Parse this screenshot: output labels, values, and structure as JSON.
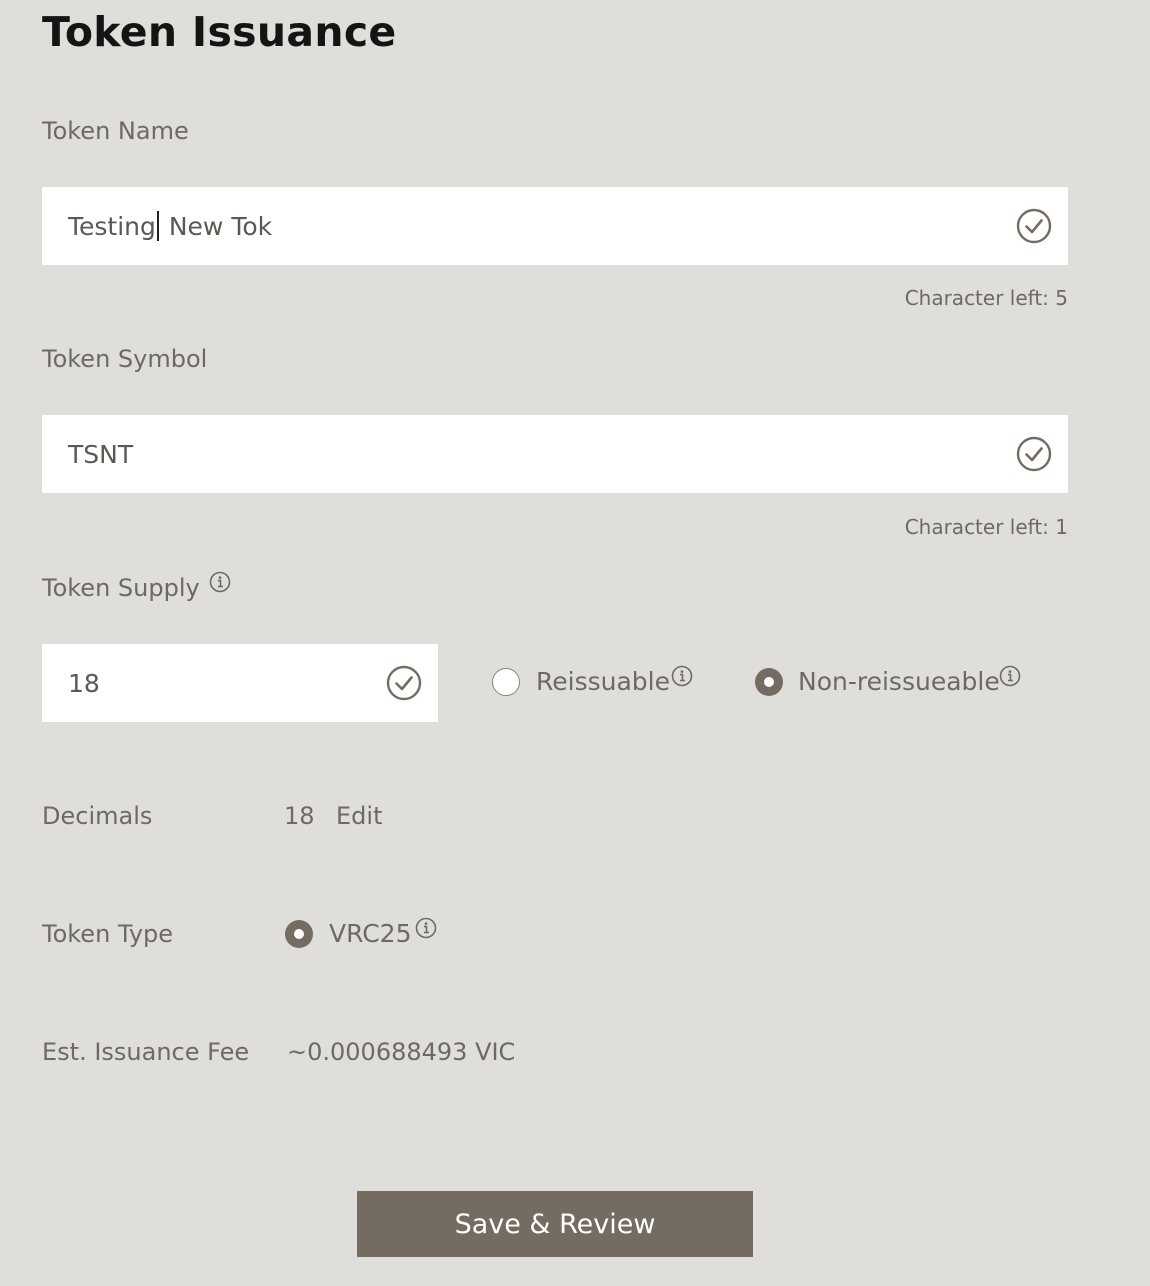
{
  "page": {
    "title": "Token Issuance"
  },
  "token_name": {
    "label": "Token Name",
    "value_before_caret": "Testing",
    "value_after_caret": " New Tok",
    "hint": "Character left: 5"
  },
  "token_symbol": {
    "label": "Token Symbol",
    "value": "TSNT",
    "hint": "Character left: 1"
  },
  "token_supply": {
    "label": "Token Supply",
    "value": "18",
    "options": [
      {
        "label": "Reissuable",
        "selected": false
      },
      {
        "label": "Non-reissueable",
        "selected": true
      }
    ]
  },
  "decimals": {
    "label": "Decimals",
    "value": "18",
    "edit_label": "Edit"
  },
  "token_type": {
    "label": "Token Type",
    "option": "VRC25",
    "selected": true
  },
  "fee": {
    "label": "Est. Issuance Fee",
    "value": "~0.000688493 VIC"
  },
  "actions": {
    "submit_label": "Save & Review"
  },
  "icons": {
    "valid": "check-circle-icon",
    "info": "info-circle-icon"
  },
  "colors": {
    "background": "#dfdeda",
    "accent": "#746b61",
    "title": "#141414",
    "text": "#6e6a63"
  }
}
